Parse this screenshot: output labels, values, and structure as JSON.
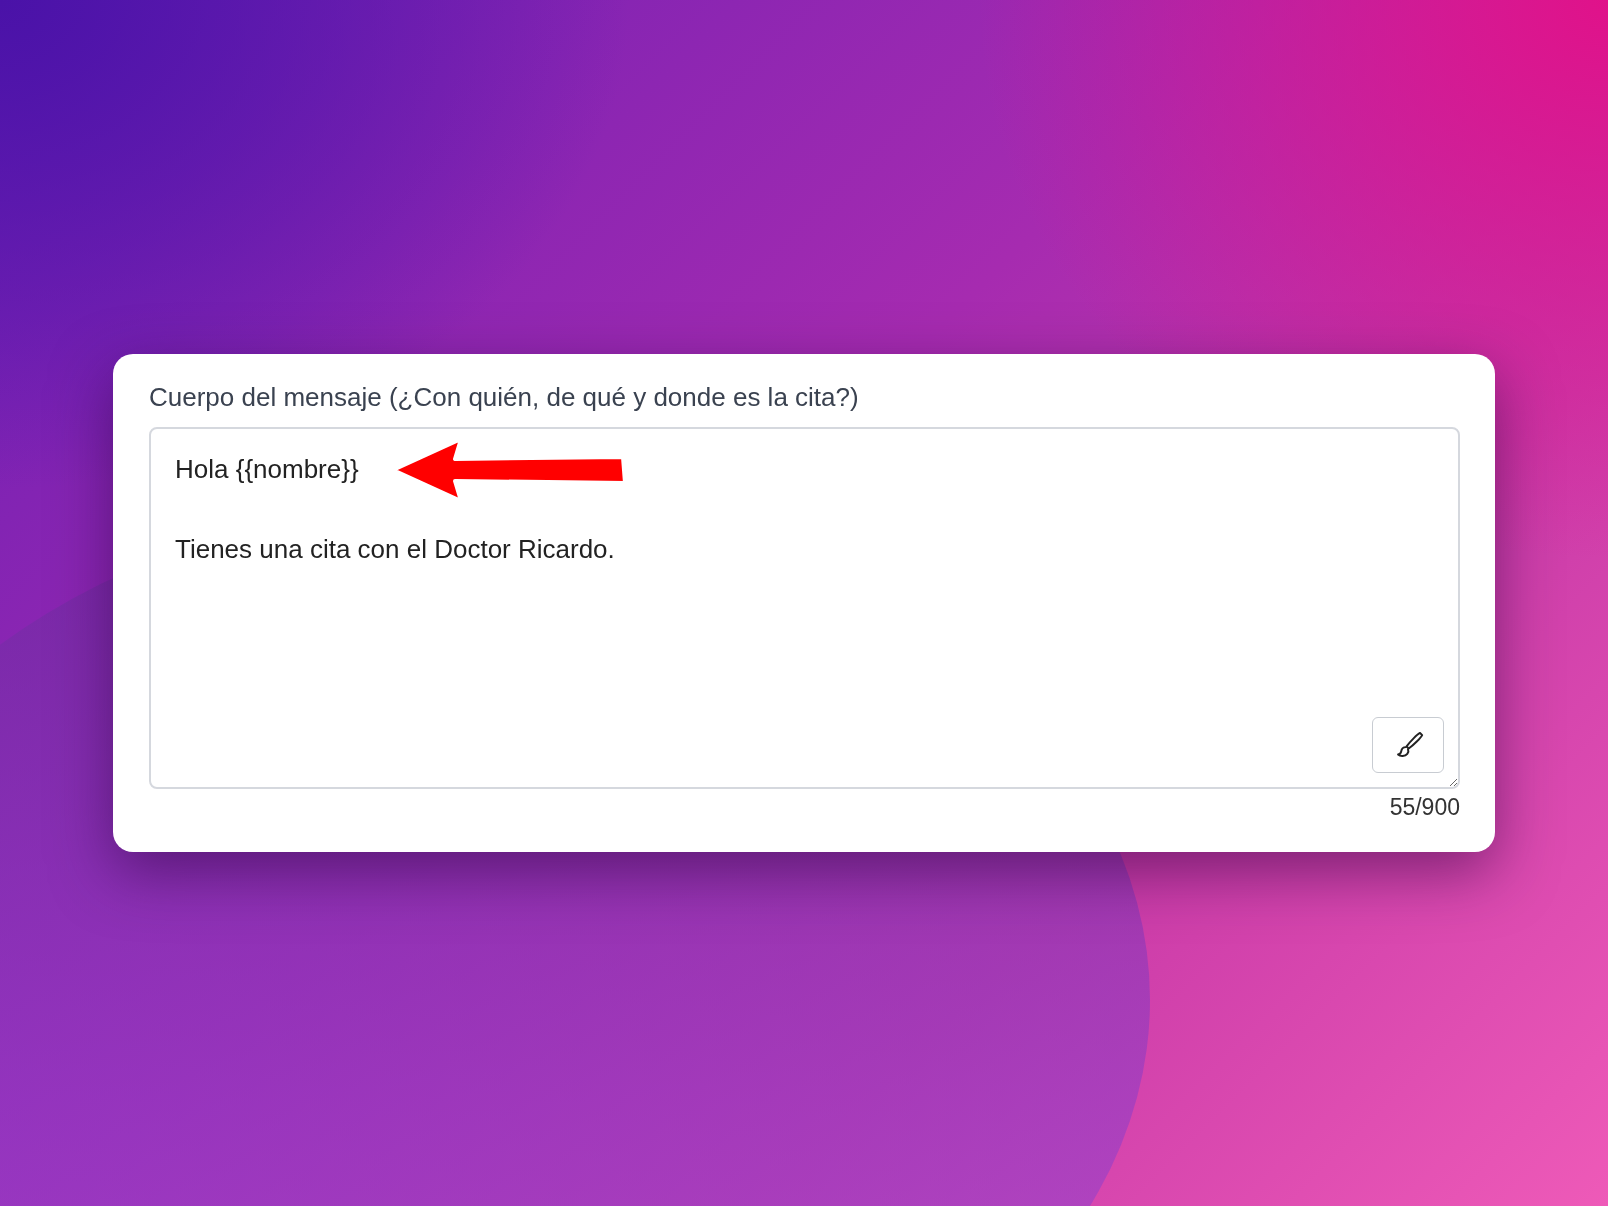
{
  "field": {
    "label": "Cuerpo del mensaje (¿Con quién, de qué y donde es la cita?)",
    "value": "Hola {{nombre}}\n\nTienes una cita con el Doctor Ricardo.",
    "counter": "55/900"
  },
  "annotation": {
    "kind": "arrow"
  }
}
